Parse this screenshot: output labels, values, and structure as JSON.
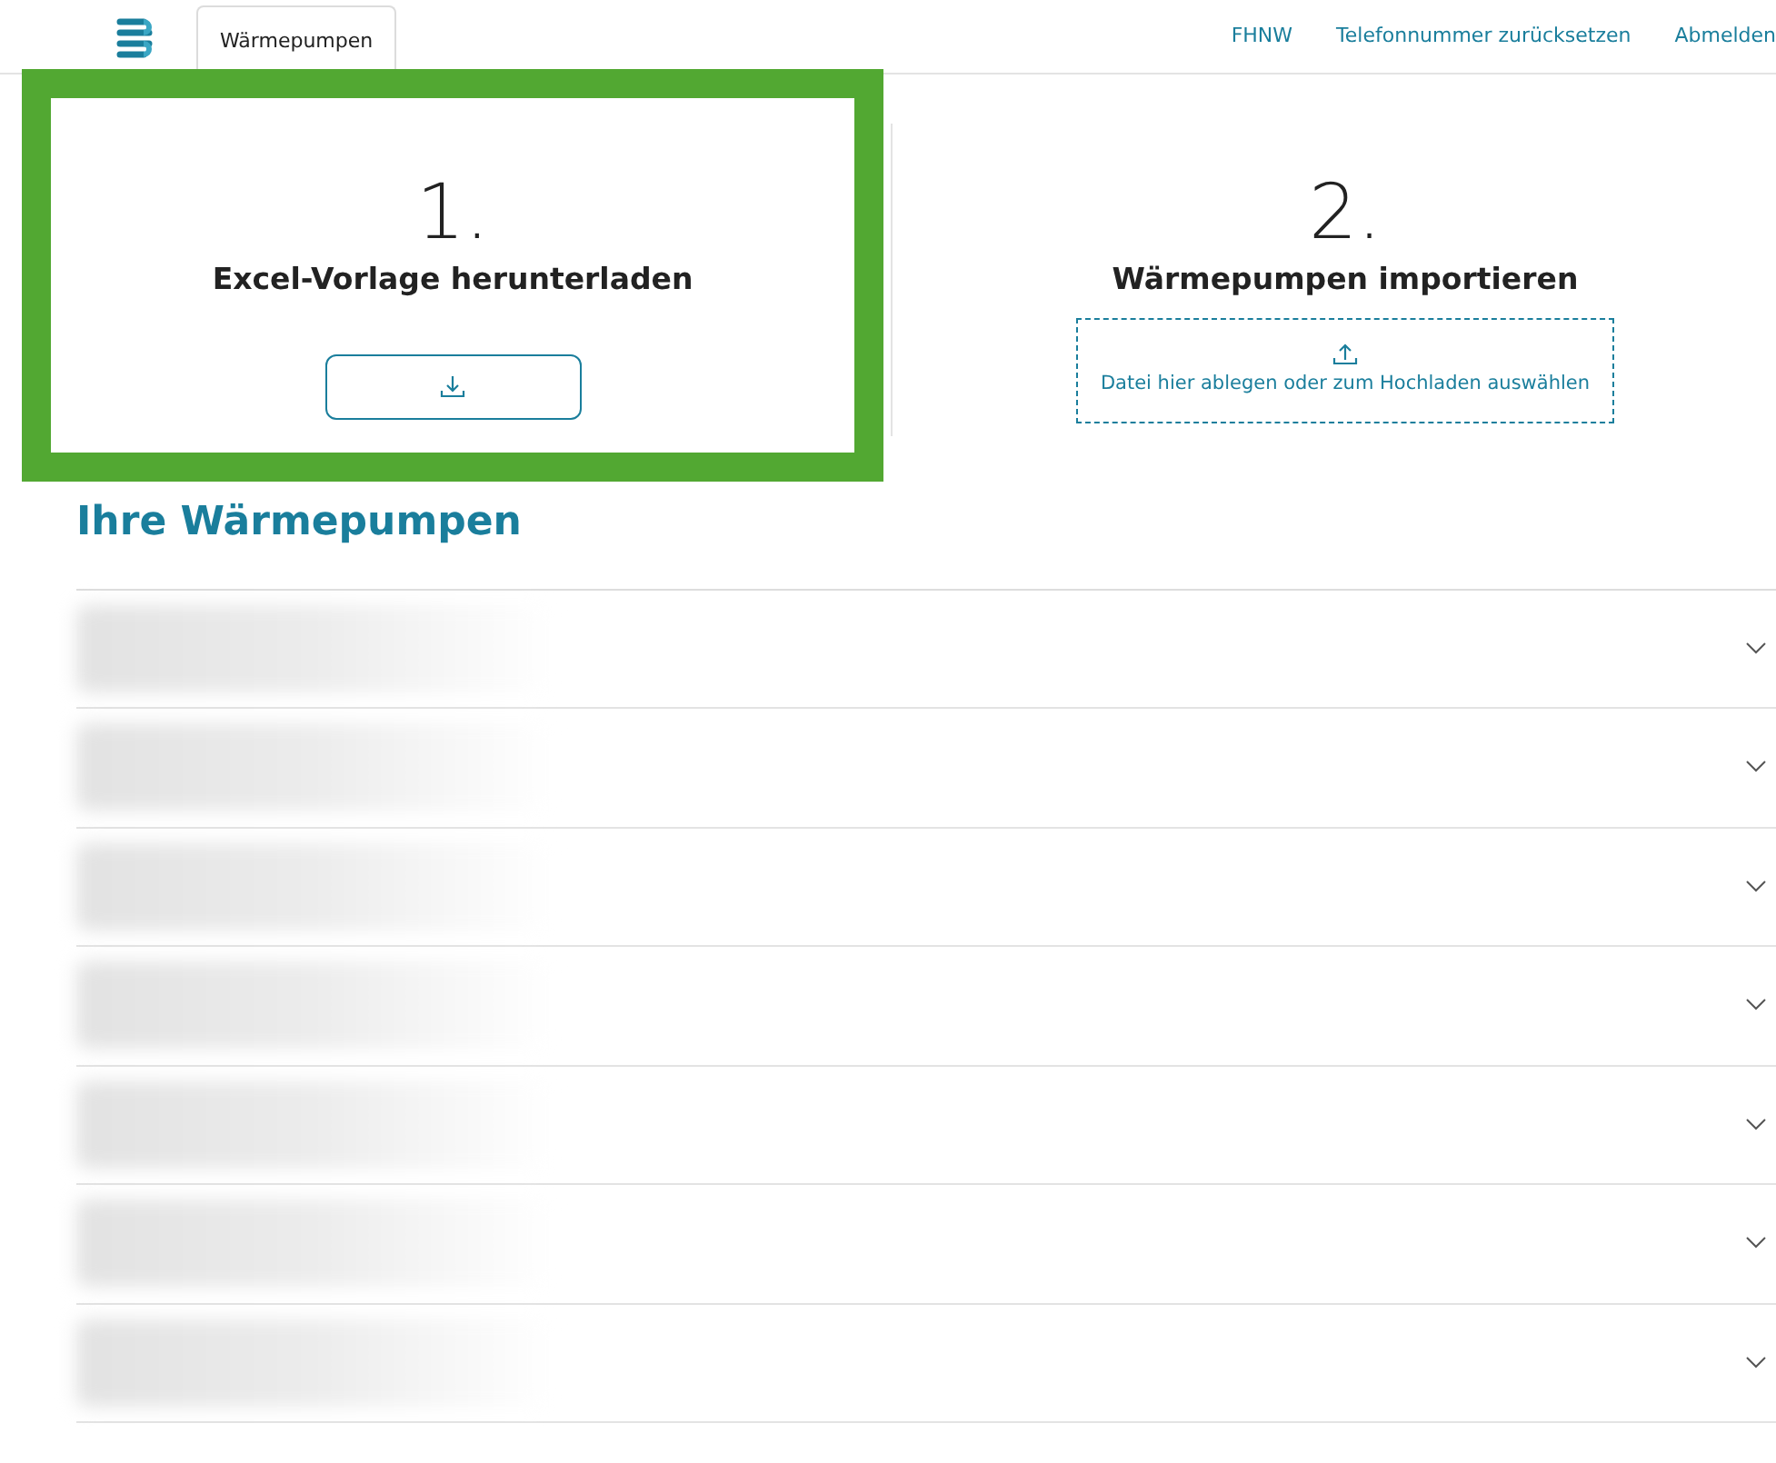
{
  "navbar": {
    "tabs": [
      {
        "label": "Wärmepumpen",
        "selected": true
      }
    ],
    "links": [
      "FHNW",
      "Telefonnummer zurücksetzen",
      "Abmelden"
    ]
  },
  "steps": [
    {
      "number": "1.",
      "title": "Excel-Vorlage herunterladen",
      "kind": "download",
      "highlighted": true
    },
    {
      "number": "2.",
      "title": "Wärmepumpen importieren",
      "kind": "upload",
      "highlighted": false,
      "dropzone_text": "Datei hier ablegen oder zum Hochladen auswählen"
    }
  ],
  "list": {
    "title": "Ihre Wärmepumpen",
    "items": [
      {
        "expanded": false
      },
      {
        "expanded": false
      },
      {
        "expanded": false
      },
      {
        "expanded": false
      },
      {
        "expanded": false
      },
      {
        "expanded": false
      },
      {
        "expanded": false
      }
    ]
  }
}
